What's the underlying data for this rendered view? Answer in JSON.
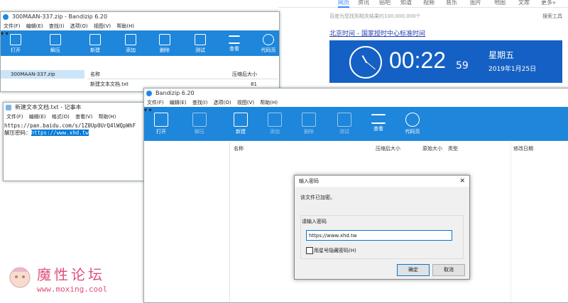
{
  "browser": {
    "tabs": [
      "网页",
      "资讯",
      "贴吧",
      "知道",
      "视频",
      "音乐",
      "图片",
      "地图",
      "文库",
      "更多»"
    ],
    "result_count": "百度为您找到相关结果约100,000,000个",
    "tools": "搜索工具",
    "result_link": "北京时间 - 国家授时中心标准时间",
    "clock": {
      "time": "00:22",
      "seconds": "59",
      "weekday": "星期五",
      "date": "2019年1月25日"
    }
  },
  "bandizip1": {
    "title": "300MAAN-337.zip - Bandizip 6.20",
    "menu": [
      "文件(F)",
      "编辑(E)",
      "查找(I)",
      "选项(O)",
      "视图(V)",
      "帮助(H)"
    ],
    "toolbar": [
      "打开",
      "解压",
      "新建",
      "添加",
      "删除",
      "测试",
      "查看",
      "代码页"
    ],
    "tree_item": "300MAAN-337.zip",
    "columns": {
      "name": "名称",
      "compressed": "压缩后大小"
    },
    "rows": [
      {
        "name": "新建文本文档.txt",
        "size": "81"
      }
    ]
  },
  "notepad": {
    "title": "新建文本文档.txt - 记事本",
    "menu": [
      "文件(F)",
      "编辑(E)",
      "格式(O)",
      "查看(V)",
      "帮助(H)"
    ],
    "line1": "https://pan.baidu.com/s/1Z0Up0UrQ4lWQpWhF",
    "line2_label": "解压密码：",
    "line2_selected": "https://www.xhd.tw"
  },
  "bandizip2": {
    "title": "Bandizip 6.20",
    "menu": [
      "文件(F)",
      "编辑(E)",
      "查找(I)",
      "选项(O)",
      "视图(V)",
      "帮助(H)"
    ],
    "toolbar": [
      "打开",
      "解压",
      "新建",
      "添加",
      "删除",
      "测试",
      "查看",
      "代码页"
    ],
    "columns": {
      "name": "名称",
      "compressed": "压缩后大小",
      "original": "原始大小",
      "type": "类型",
      "modified": "修改日期"
    }
  },
  "dialog": {
    "title": "输入密码",
    "close": "✕",
    "message": "该文件已加密。",
    "prompt": "请输入密码",
    "password_value": "https://www.xhd.tw",
    "hide_label": "用星号隐藏密码(H)",
    "ok": "确定",
    "cancel": "取消"
  },
  "watermark": {
    "name": "魔性论坛",
    "url": "www.moxing.cool"
  }
}
